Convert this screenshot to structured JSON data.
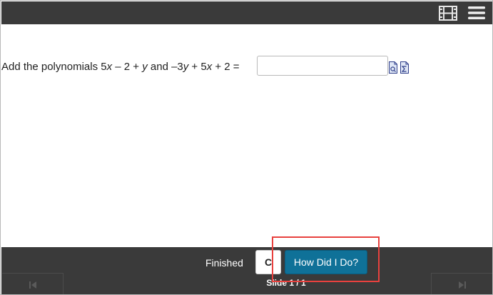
{
  "toolbar": {
    "icons": [
      "film-icon",
      "hamburger-menu-icon"
    ]
  },
  "question": {
    "text_parts": [
      "Add the polynomials 5",
      "x",
      " – 2 + ",
      "y",
      " and –3",
      "y",
      " + 5",
      "x",
      " + 2 ="
    ],
    "answer_value": "",
    "answer_placeholder": "",
    "tool_icons": [
      "equation-editor-icon",
      "summation-tool-icon"
    ]
  },
  "footer": {
    "finished_label": "Finished",
    "c_button_label": "C",
    "how_button_label": "How Did I Do?",
    "slide_counter": "Slide 1 / 1",
    "nav_icons": [
      "previous-slide-icon",
      "next-slide-icon"
    ]
  },
  "colors": {
    "bar_background": "#3a3a3a",
    "button_primary": "#0f7198",
    "highlight": "#e8413e"
  }
}
